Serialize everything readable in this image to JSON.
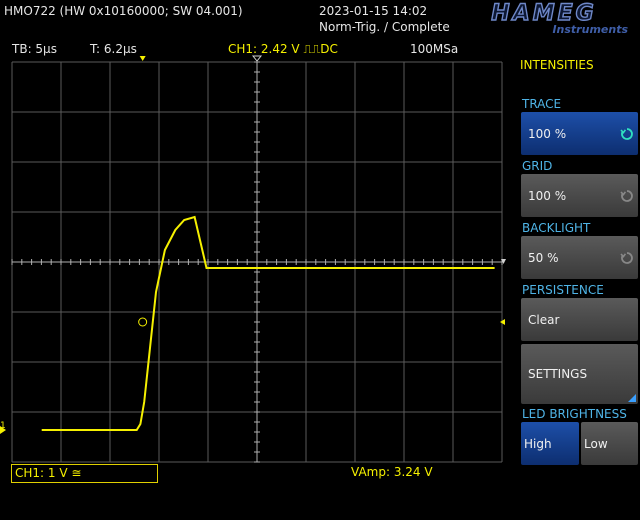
{
  "header": {
    "device": "HMO722 (HW 0x10160000; SW 04.001)",
    "datetime": "2023-01-15 14:02",
    "status": "Norm-Trig. / Complete",
    "logo_main": "HAMEG",
    "logo_sub": "Instruments"
  },
  "info_bar": {
    "timebase": "TB: 5µs",
    "trigger_time": "T: 6.2µs",
    "channel": "CH1: 2.42 V ⎍⎍DC",
    "sample_rate": "100MSa"
  },
  "footer": {
    "channel_setting": "CH1: 1 V ≅",
    "measurement": "VAmp: 3.24 V"
  },
  "marker": {
    "ch1_ground": "1"
  },
  "sidebar": {
    "title": "INTENSITIES",
    "trace": {
      "label": "TRACE",
      "value": "100 %"
    },
    "grid": {
      "label": "GRID",
      "value": "100 %"
    },
    "backlight": {
      "label": "BACKLIGHT",
      "value": "50 %"
    },
    "persistence": {
      "label": "PERSISTENCE",
      "clear": "Clear",
      "settings": "SETTINGS"
    },
    "led": {
      "label": "LED BRIGHTNESS",
      "high": "High",
      "low": "Low",
      "selected": "High"
    }
  },
  "colors": {
    "trace": "#f5f000",
    "accent_blue": "#1d4fa8",
    "label_blue": "#4fb4e6"
  },
  "chart_data": {
    "type": "line",
    "title": "",
    "xlabel": "",
    "ylabel": "",
    "x_units": "µs",
    "y_units": "V",
    "x": [
      -29,
      -16.2,
      -15.7,
      -15.2,
      -14.4,
      -13.6,
      -12.4,
      -11,
      -9.8,
      -8.4,
      -6.8,
      0,
      10,
      20,
      32
    ],
    "series": [
      {
        "values": [
          -3.36,
          -3.36,
          -3.24,
          -2.8,
          -1.7,
          -0.6,
          0.24,
          0.64,
          0.84,
          0.9,
          -0.12,
          -0.12,
          -0.12,
          -0.12,
          -0.12
        ]
      }
    ],
    "series_note_removed": true,
    "xlim": [
      -33,
      33
    ],
    "ylim": [
      -4,
      4
    ],
    "divisions": {
      "x": 10,
      "y": 8
    },
    "grid": true
  }
}
